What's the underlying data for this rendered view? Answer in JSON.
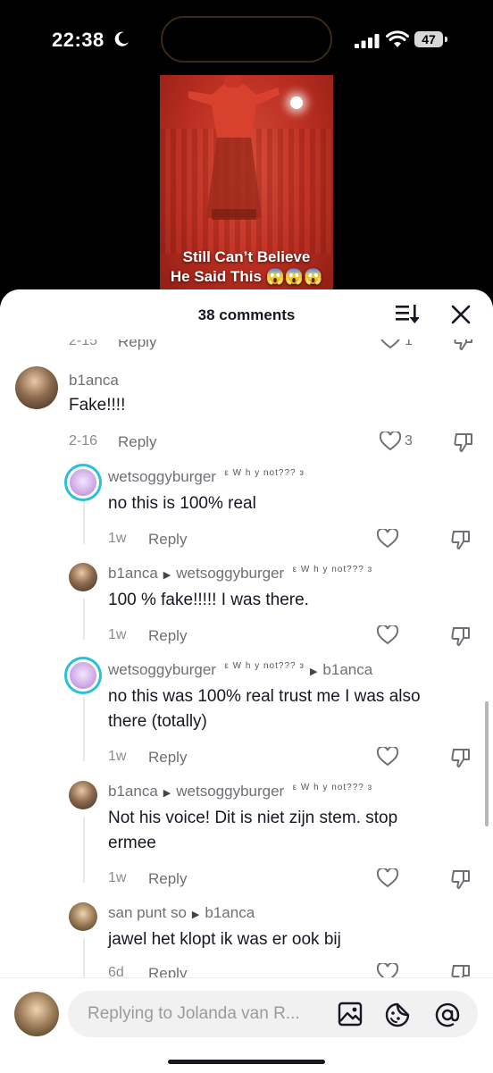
{
  "status_bar": {
    "time": "22:38",
    "battery": "47"
  },
  "video": {
    "caption_line1": "Still Can’t Believe",
    "caption_line2": "He Said This 😱😱😱"
  },
  "header": {
    "comment_count": "38 comments"
  },
  "comments": [
    {
      "date": "2-15",
      "reply": "Reply",
      "likes": "1"
    },
    {
      "username": "b1anca",
      "text": "Fake!!!!",
      "date": "2-16",
      "reply": "Reply",
      "likes": "3"
    },
    {
      "username": "wetsoggyburger",
      "user_deco": "ε W h y not??? ɜ",
      "text": "no this is 100% real",
      "date": "1w",
      "reply": "Reply"
    },
    {
      "username": "b1anca",
      "reply_to": "wetsoggyburger",
      "reply_to_deco": "ε W h y not??? ɜ",
      "text": "100 % fake!!!!! I was there.",
      "date": "1w",
      "reply": "Reply"
    },
    {
      "username": "wetsoggyburger",
      "user_deco": "ε W h y not??? ɜ",
      "reply_to": "b1anca",
      "text_line1": "no this was 100% real trust me I was also",
      "text_line2": "there (totally)",
      "date": "1w",
      "reply": "Reply"
    },
    {
      "username": "b1anca",
      "reply_to": "wetsoggyburger",
      "reply_to_deco": "ε W h y not??? ɜ",
      "text_line1": "Not his voice! Dit is niet zijn stem. stop",
      "text_line2": "ermee",
      "date": "1w",
      "reply": "Reply"
    },
    {
      "username": "san punt so",
      "reply_to": "b1anca",
      "text": "jawel het klopt ik was er ook bij",
      "date": "6d",
      "reply": "Reply"
    }
  ],
  "input": {
    "placeholder": "Replying to Jolanda van R..."
  }
}
